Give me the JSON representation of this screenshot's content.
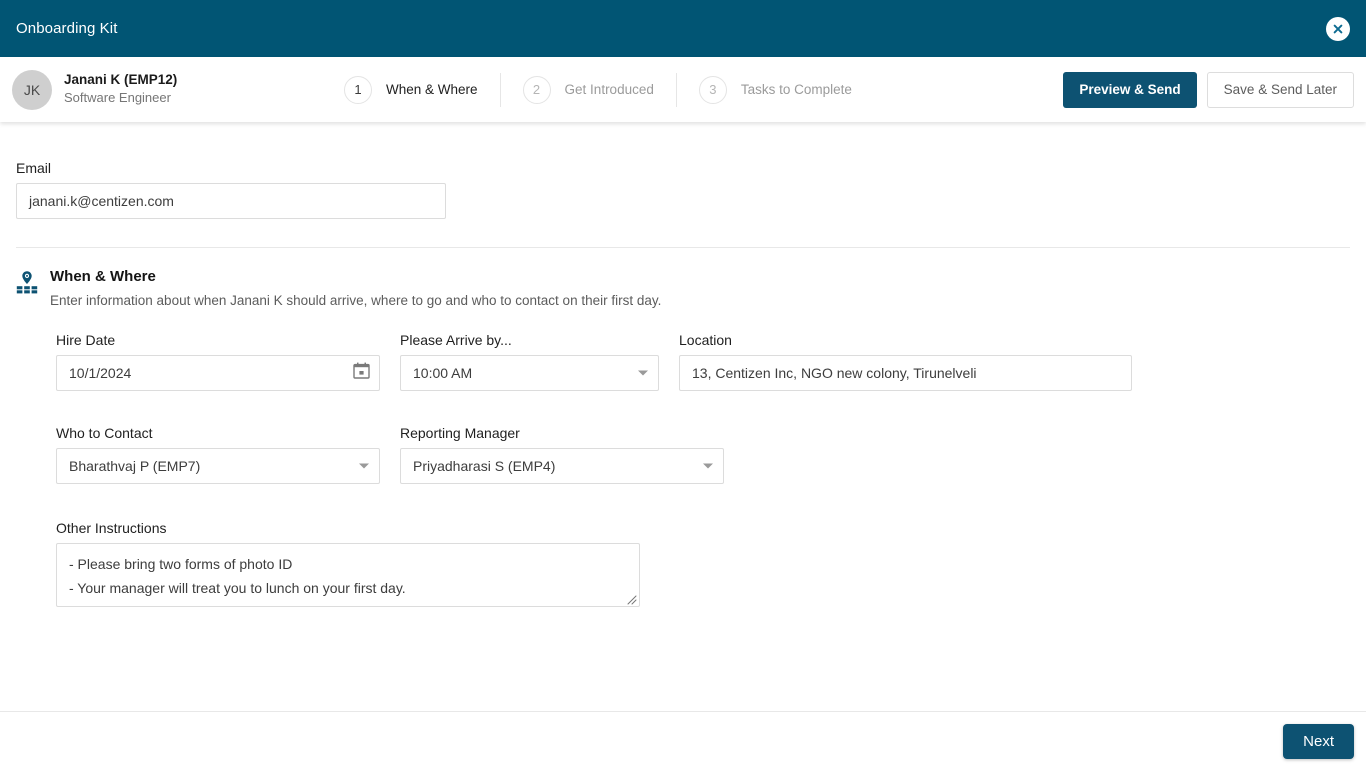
{
  "window": {
    "title": "Onboarding Kit",
    "close_icon": "close-circle-icon"
  },
  "profile": {
    "initials": "JK",
    "name": "Janani K (EMP12)",
    "role": "Software Engineer"
  },
  "stepper": {
    "steps": [
      {
        "number": "1",
        "label": "When & Where",
        "active": true
      },
      {
        "number": "2",
        "label": "Get Introduced",
        "active": false
      },
      {
        "number": "3",
        "label": "Tasks to Complete",
        "active": false
      }
    ]
  },
  "header_actions": {
    "preview_send": "Preview & Send",
    "save_send_later": "Save & Send Later"
  },
  "form": {
    "email": {
      "label": "Email",
      "value": "janani.k@centizen.com",
      "placeholder": "Email"
    },
    "section": {
      "icon": "map-pin-icon",
      "title": "When & Where",
      "description": "Enter information about when Janani K should arrive, where to go and who to contact on their first day."
    },
    "hire_date": {
      "label": "Hire Date",
      "value": "10/1/2024",
      "placeholder": "mm/dd/yyyy",
      "icon": "calendar-icon"
    },
    "arrive_by": {
      "label": "Please Arrive by...",
      "value": "10:00 AM",
      "icon": "chevron-down-icon"
    },
    "location": {
      "label": "Location",
      "value": "13, Centizen Inc, NGO new colony, Tirunelveli",
      "placeholder": "Location"
    },
    "who_to_contact": {
      "label": "Who to Contact",
      "value": "Bharathvaj P (EMP7)",
      "icon": "chevron-down-icon"
    },
    "reporting_manager": {
      "label": "Reporting Manager",
      "value": "Priyadharasi S (EMP4)",
      "icon": "chevron-down-icon"
    },
    "other_instructions": {
      "label": "Other Instructions",
      "value": "- Please bring two forms of photo ID\n- Your manager will treat you to lunch on your first day.",
      "placeholder": "Other Instructions"
    }
  },
  "footer": {
    "next": "Next"
  },
  "colors": {
    "titlebar": "#015574",
    "primary_button": "#0d5272",
    "accent_icon": "#0d5272",
    "border": "#dcdcdc",
    "avatar_bg": "#cfcfcf"
  }
}
